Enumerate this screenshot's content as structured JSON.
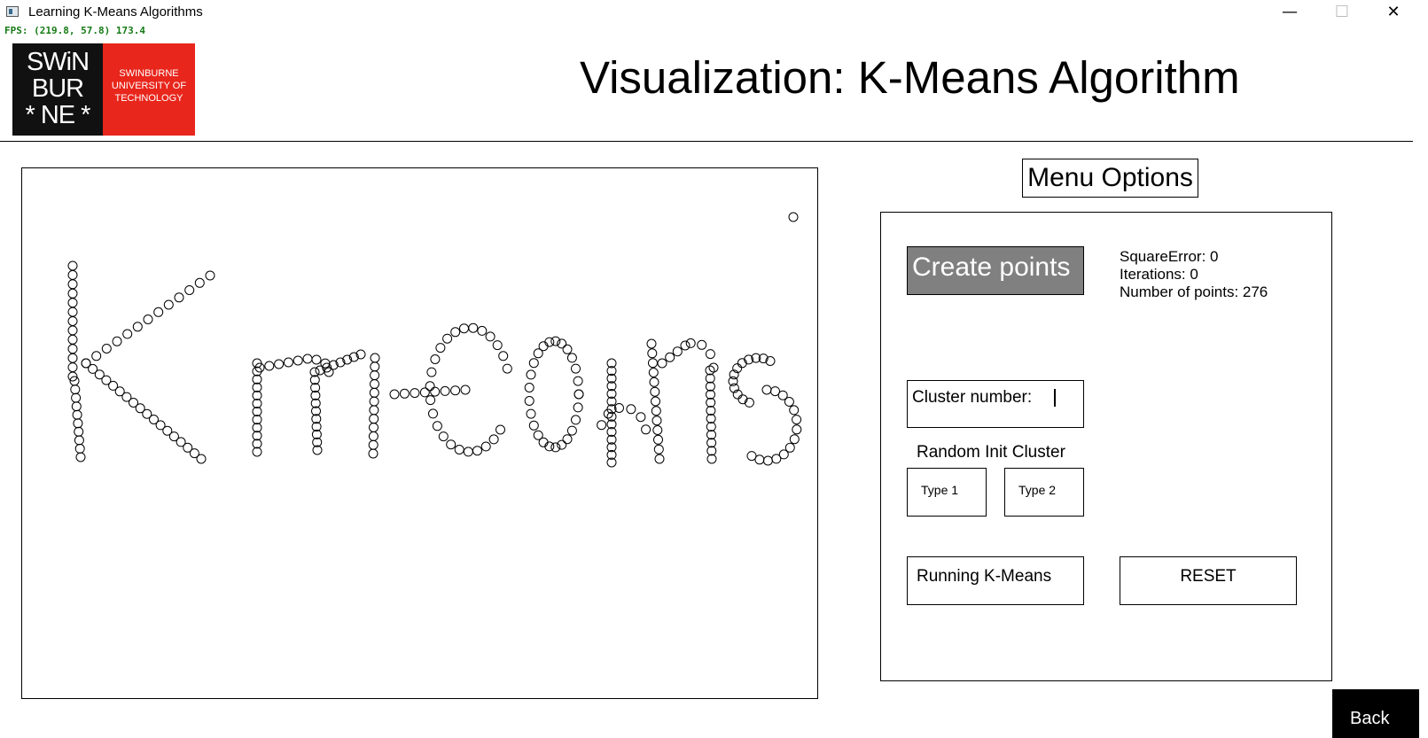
{
  "window": {
    "title": "Learning K-Means Algorithms",
    "minimize_glyph": "—",
    "maximize_glyph": "☐",
    "close_glyph": "✕"
  },
  "fps_text": "FPS: (219.8, 57.8) 173.4",
  "logo": {
    "wordmark_lines": [
      "SWiN",
      "BUR",
      "* NE *"
    ],
    "name_lines": [
      "SWINBURNE",
      "UNIVERSITY OF",
      "TECHNOLOGY"
    ]
  },
  "page_title": "Visualization: K-Means Algorithm",
  "menu": {
    "title": "Menu Options",
    "create_points_label": "Create points",
    "stats": {
      "square_error": "SquareError: 0",
      "iterations": "Iterations: 0",
      "num_points": "Number of points: 276"
    },
    "cluster_label": "Cluster number:",
    "cluster_value": "",
    "random_init_label": "Random Init Cluster",
    "type1_label": "Type 1",
    "type2_label": "Type 2",
    "running_label": "Running K-Means",
    "reset_label": "RESET",
    "back_label": "Back"
  },
  "colors": {
    "create_button_bg": "#808080",
    "logo_red": "#e8261c",
    "logo_black": "#111111",
    "fps_green": "#157a15"
  },
  "points_shape": "K-means"
}
